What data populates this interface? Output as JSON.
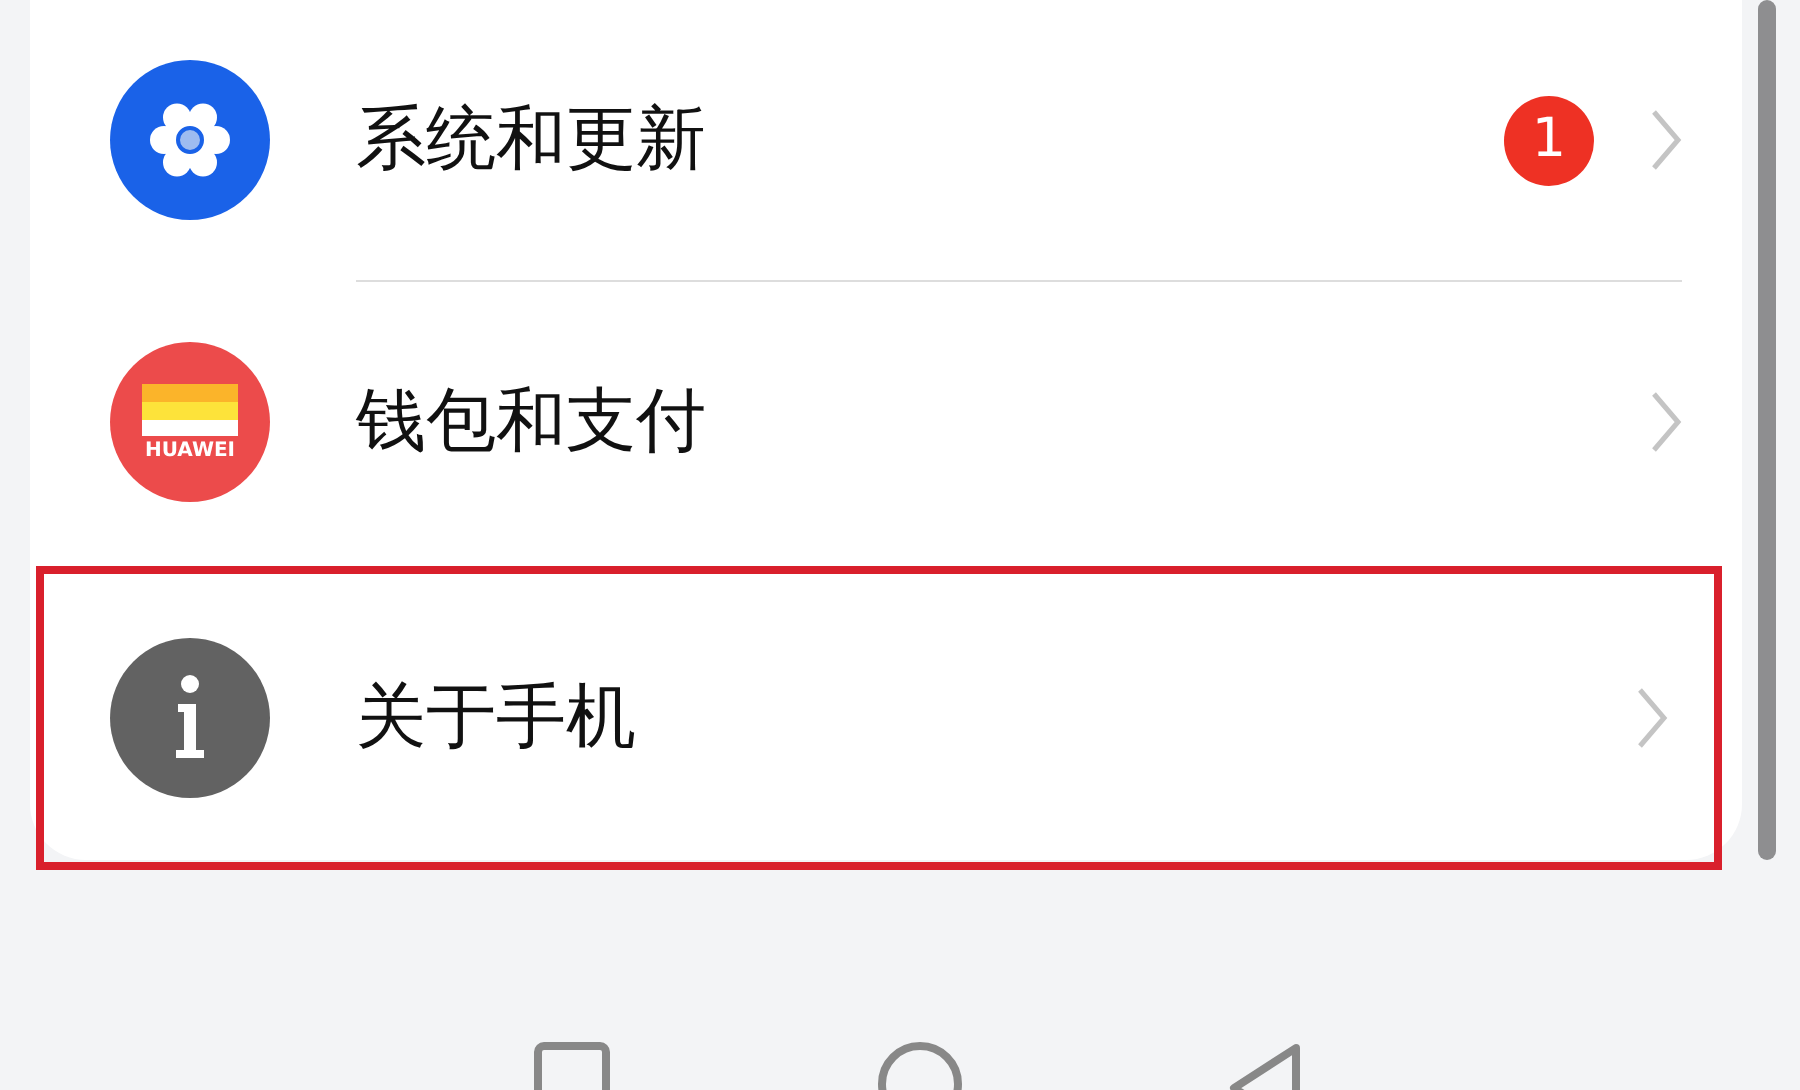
{
  "settings_items": [
    {
      "kind": "gear",
      "label": "系统和更新",
      "badge": "1",
      "highlighted": false
    },
    {
      "kind": "wallet",
      "icon_text": "HUAWEI",
      "label": "钱包和支付",
      "highlighted": false
    },
    {
      "kind": "info",
      "label": "关于手机",
      "highlighted": true
    }
  ],
  "nav_bar": [
    {
      "kind": "recents"
    },
    {
      "kind": "home"
    },
    {
      "kind": "back"
    }
  ]
}
